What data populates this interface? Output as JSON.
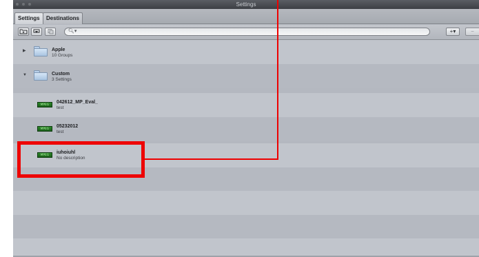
{
  "window": {
    "title": "Settings"
  },
  "tabs": [
    {
      "label": "Settings",
      "selected": true
    },
    {
      "label": "Destinations",
      "selected": false
    }
  ],
  "toolbar": {
    "new_folder_icon": "folder-plus-icon",
    "import_icon": "import-icon",
    "duplicate_icon": "duplicate-icon",
    "search_placeholder": "",
    "search_icon": "search-icon",
    "add_label": "+▾",
    "remove_label": "−"
  },
  "list": {
    "groups": [
      {
        "name": "Apple",
        "subtitle": "10 Groups",
        "expanded": false
      },
      {
        "name": "Custom",
        "subtitle": "3 Settings",
        "expanded": true
      }
    ],
    "settings": [
      {
        "badge": "MPEG",
        "name": "042612_MP_Eval_",
        "description": "test"
      },
      {
        "badge": "MPEG",
        "name": "05232012",
        "description": "test"
      },
      {
        "badge": "MPEG",
        "name": "iuhoiuhl",
        "description": "No description"
      }
    ]
  },
  "annotation": {
    "color": "#ee0000",
    "highlighted_item": "iuhoiuhl"
  },
  "colors": {
    "row_light": "#c1c5cc",
    "row_dark": "#b5b9c1",
    "badge_green": "#2c8a2a"
  }
}
